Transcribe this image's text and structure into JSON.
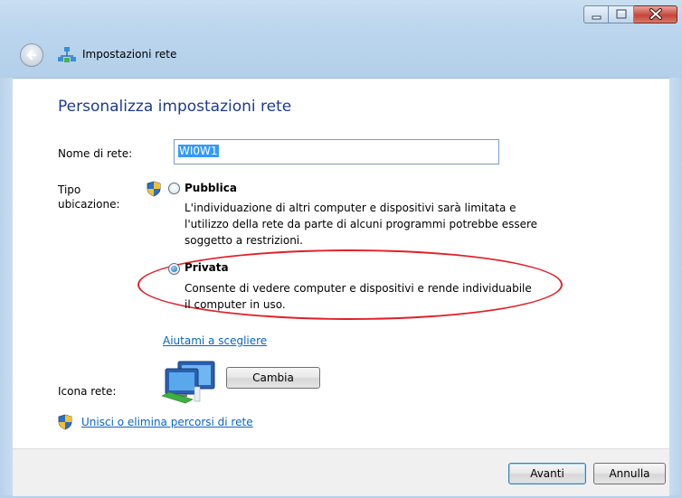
{
  "window": {
    "title": "Impostazioni rete",
    "controls": [
      "minimize-icon",
      "maximize-icon",
      "close-icon"
    ]
  },
  "heading": "Personalizza impostazioni rete",
  "network_name": {
    "label": "Nome di rete:",
    "value": "WI0W1"
  },
  "location_type": {
    "label_line1": "Tipo",
    "label_line2": "ubicazione:",
    "options": [
      {
        "title": "Pubblica",
        "selected": false,
        "desc_lines": [
          "L'individuazione di altri computer e dispositivi sarà limitata e",
          "l'utilizzo della rete da parte di alcuni programmi potrebbe essere",
          "soggetto a restrizioni."
        ]
      },
      {
        "title": "Privata",
        "selected": true,
        "desc_lines": [
          "Consente di vedere computer e dispositivi e rende individuabile",
          "il computer in uso."
        ]
      }
    ]
  },
  "help_link": "Aiutami a scegliere",
  "network_icon": {
    "label": "Icona rete:",
    "change_button": "Cambia"
  },
  "merge_link": "Unisci o elimina percorsi di rete",
  "footer": {
    "next_button": "Avanti",
    "cancel_button": "Annulla"
  },
  "colors": {
    "heading": "#1e3c8c",
    "link": "#0a64c8",
    "highlight_ellipse": "#e2202a",
    "titlebar": "#bcd6ee"
  }
}
